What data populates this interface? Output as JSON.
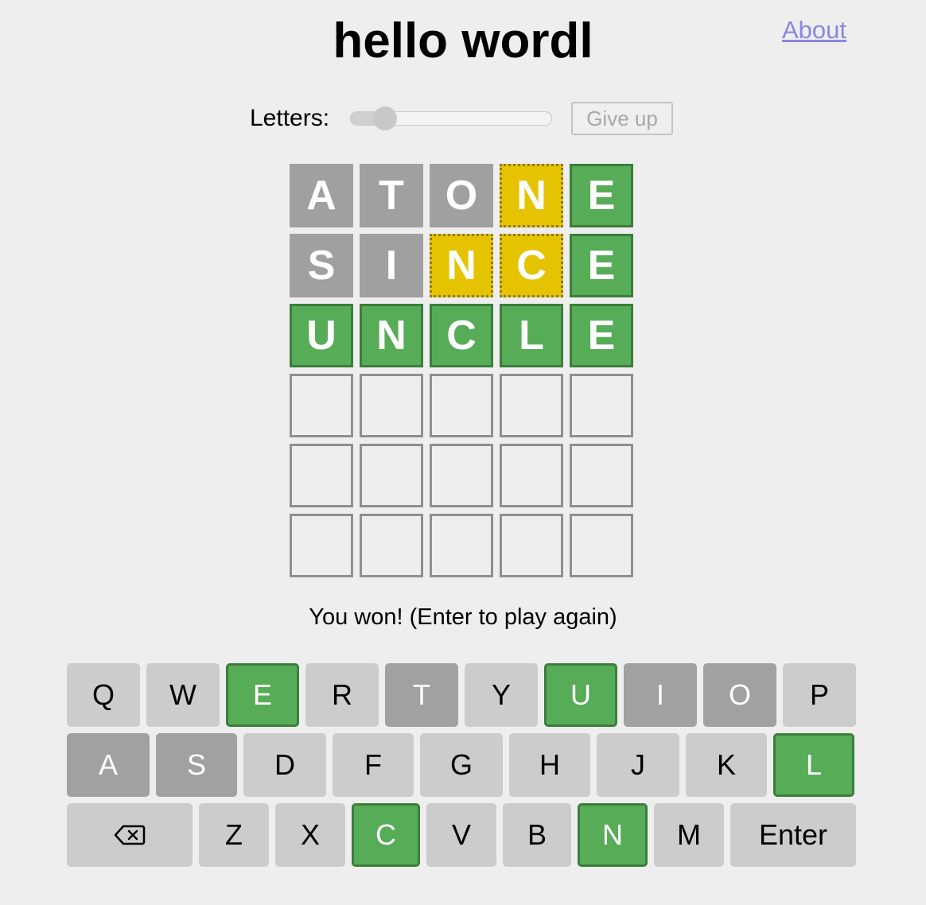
{
  "header": {
    "title": "hello wordl",
    "about_label": "About"
  },
  "controls": {
    "letters_label": "Letters:",
    "slider_fraction": 0.17,
    "give_up_label": "Give up"
  },
  "board": {
    "rows": [
      [
        {
          "letter": "A",
          "state": "absent"
        },
        {
          "letter": "T",
          "state": "absent"
        },
        {
          "letter": "O",
          "state": "absent"
        },
        {
          "letter": "N",
          "state": "elsewhere"
        },
        {
          "letter": "E",
          "state": "correct"
        }
      ],
      [
        {
          "letter": "S",
          "state": "absent"
        },
        {
          "letter": "I",
          "state": "absent"
        },
        {
          "letter": "N",
          "state": "elsewhere"
        },
        {
          "letter": "C",
          "state": "elsewhere"
        },
        {
          "letter": "E",
          "state": "correct"
        }
      ],
      [
        {
          "letter": "U",
          "state": "correct"
        },
        {
          "letter": "N",
          "state": "correct"
        },
        {
          "letter": "C",
          "state": "correct"
        },
        {
          "letter": "L",
          "state": "correct"
        },
        {
          "letter": "E",
          "state": "correct"
        }
      ],
      [
        {
          "letter": "",
          "state": "empty"
        },
        {
          "letter": "",
          "state": "empty"
        },
        {
          "letter": "",
          "state": "empty"
        },
        {
          "letter": "",
          "state": "empty"
        },
        {
          "letter": "",
          "state": "empty"
        }
      ],
      [
        {
          "letter": "",
          "state": "empty"
        },
        {
          "letter": "",
          "state": "empty"
        },
        {
          "letter": "",
          "state": "empty"
        },
        {
          "letter": "",
          "state": "empty"
        },
        {
          "letter": "",
          "state": "empty"
        }
      ],
      [
        {
          "letter": "",
          "state": "empty"
        },
        {
          "letter": "",
          "state": "empty"
        },
        {
          "letter": "",
          "state": "empty"
        },
        {
          "letter": "",
          "state": "empty"
        },
        {
          "letter": "",
          "state": "empty"
        }
      ]
    ]
  },
  "status": {
    "message": "You won! (Enter to play again)"
  },
  "keyboard": {
    "rows": [
      [
        {
          "label": "Q",
          "state": "unused"
        },
        {
          "label": "W",
          "state": "unused"
        },
        {
          "label": "E",
          "state": "correct"
        },
        {
          "label": "R",
          "state": "unused"
        },
        {
          "label": "T",
          "state": "absent"
        },
        {
          "label": "Y",
          "state": "unused"
        },
        {
          "label": "U",
          "state": "correct"
        },
        {
          "label": "I",
          "state": "absent"
        },
        {
          "label": "O",
          "state": "absent"
        },
        {
          "label": "P",
          "state": "unused"
        }
      ],
      [
        {
          "label": "A",
          "state": "absent"
        },
        {
          "label": "S",
          "state": "absent"
        },
        {
          "label": "D",
          "state": "unused"
        },
        {
          "label": "F",
          "state": "unused"
        },
        {
          "label": "G",
          "state": "unused"
        },
        {
          "label": "H",
          "state": "unused"
        },
        {
          "label": "J",
          "state": "unused"
        },
        {
          "label": "K",
          "state": "unused"
        },
        {
          "label": "L",
          "state": "correct"
        }
      ],
      [
        {
          "label": "",
          "icon": "backspace-icon",
          "state": "unused"
        },
        {
          "label": "Z",
          "state": "unused"
        },
        {
          "label": "X",
          "state": "unused"
        },
        {
          "label": "C",
          "state": "correct"
        },
        {
          "label": "V",
          "state": "unused"
        },
        {
          "label": "B",
          "state": "unused"
        },
        {
          "label": "N",
          "state": "correct"
        },
        {
          "label": "M",
          "state": "unused"
        },
        {
          "label": "Enter",
          "state": "unused"
        }
      ]
    ]
  },
  "colors": {
    "correct": "#57ac57",
    "elsewhere": "#e6c300",
    "absent": "#a0a0a0",
    "key_default": "#cccccc",
    "link": "#8b86e0"
  }
}
